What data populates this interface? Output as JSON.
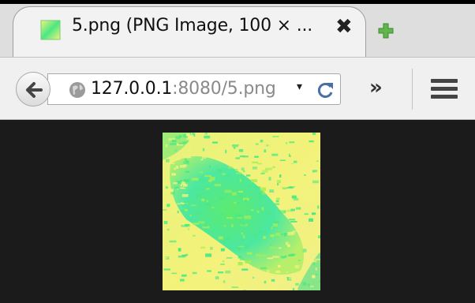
{
  "tab": {
    "title": "5.png (PNG Image, 100 × ...",
    "close_label": "✖"
  },
  "icons": {
    "favicon": "image-thumbnail-icon",
    "new_tab": "new-tab-puzzle-icon",
    "back": "back-arrow-icon",
    "site": "globe-icon",
    "reload": "reload-icon",
    "overflow": "chevron-double-right-icon",
    "menu": "hamburger-menu-icon"
  },
  "urlbar": {
    "host": "127.0.0.1",
    "rest": ":8080/5.png",
    "dropdown_glyph": "▾"
  },
  "toolbar": {
    "overflow_label": "»"
  },
  "colors": {
    "image_green": "#4be884",
    "image_yellow": "#f2f27a",
    "image_lime": "#a5ee55",
    "newtab_green": "#5fb64a",
    "background": "#1b1b1b"
  }
}
